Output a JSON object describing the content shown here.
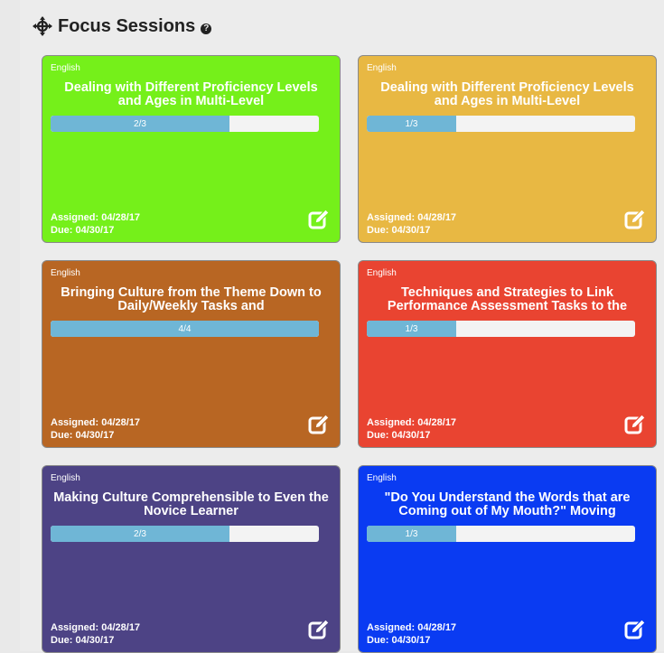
{
  "header": {
    "title": "Focus Sessions",
    "help_icon": "question-circle-icon",
    "title_icon": "crosshair-move-icon"
  },
  "cards": [
    {
      "subject": "English",
      "title": "Dealing with Different Proficiency Levels and Ages in Multi-Level",
      "progress_label": "2/3",
      "progress": 0.6667,
      "assigned": "Assigned: 04/28/17",
      "due": "Due: 04/30/17",
      "color": "#75f01a"
    },
    {
      "subject": "English",
      "title": "Dealing with Different Proficiency Levels and Ages in Multi-Level",
      "progress_label": "1/3",
      "progress": 0.3333,
      "assigned": "Assigned: 04/28/17",
      "due": "Due: 04/30/17",
      "color": "#e8b843"
    },
    {
      "subject": "English",
      "title": "Bringing Culture from the Theme Down to Daily/Weekly Tasks and",
      "progress_label": "4/4",
      "progress": 1.0,
      "assigned": "Assigned: 04/28/17",
      "due": "Due: 04/30/17",
      "color": "#b86623"
    },
    {
      "subject": "English",
      "title": "Techniques and Strategies to Link Performance Assessment Tasks to the",
      "progress_label": "1/3",
      "progress": 0.3333,
      "assigned": "Assigned: 04/28/17",
      "due": "Due: 04/30/17",
      "color": "#e94431"
    },
    {
      "subject": "English",
      "title": "Making Culture Comprehensible to Even the Novice Learner",
      "progress_label": "2/3",
      "progress": 0.6667,
      "assigned": "Assigned: 04/28/17",
      "due": "Due: 04/30/17",
      "color": "#4d4385"
    },
    {
      "subject": "English",
      "title": "\"Do You Understand the Words that are Coming out of My Mouth?\" Moving",
      "progress_label": "1/3",
      "progress": 0.3333,
      "assigned": "Assigned: 04/28/17",
      "due": "Due: 04/30/17",
      "color": "#0a3bf2"
    }
  ]
}
